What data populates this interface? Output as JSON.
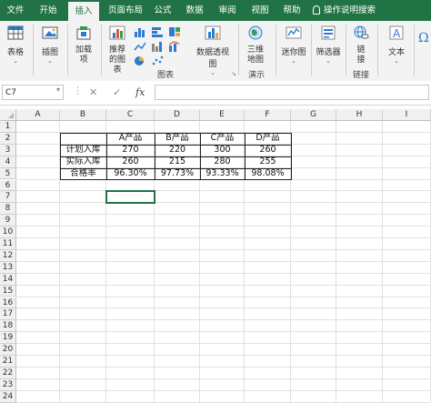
{
  "ribbon_tabs": [
    "文件",
    "开始",
    "插入",
    "页面布局",
    "公式",
    "数据",
    "审阅",
    "视图",
    "帮助",
    "操作说明搜索"
  ],
  "active_tab": "插入",
  "ribbon": {
    "table": "表格",
    "illustrations": "插图",
    "addins": "加载项",
    "recommended_charts": "推荐的图表",
    "pivot_chart": "数据透视图",
    "map_3d": "三维地图",
    "sparklines": "迷你图",
    "filter": "筛选器",
    "link": "链接",
    "text": "文本",
    "group_charts": "图表",
    "group_tours": "演示",
    "group_links": "链接"
  },
  "formula_bar": {
    "name_box": "C7",
    "cancel": "✕",
    "enter": "✓",
    "fx": "fx",
    "formula": ""
  },
  "columns": [
    "A",
    "B",
    "C",
    "D",
    "E",
    "F",
    "G",
    "H",
    "I"
  ],
  "rows": [
    "1",
    "2",
    "3",
    "4",
    "5",
    "6",
    "7",
    "8",
    "9",
    "10",
    "11",
    "12",
    "13",
    "14",
    "15",
    "16",
    "17",
    "18",
    "19",
    "20",
    "21",
    "22",
    "23",
    "24"
  ],
  "table": {
    "headers": [
      "",
      "A产品",
      "B产品",
      "C产品",
      "D产品"
    ],
    "rows": [
      [
        "计划入库",
        "270",
        "220",
        "300",
        "260"
      ],
      [
        "实际入库",
        "260",
        "215",
        "280",
        "255"
      ],
      [
        "合格率",
        "96.30%",
        "97.73%",
        "93.33%",
        "98.08%"
      ]
    ]
  },
  "colors": {
    "accent": "#217346"
  }
}
